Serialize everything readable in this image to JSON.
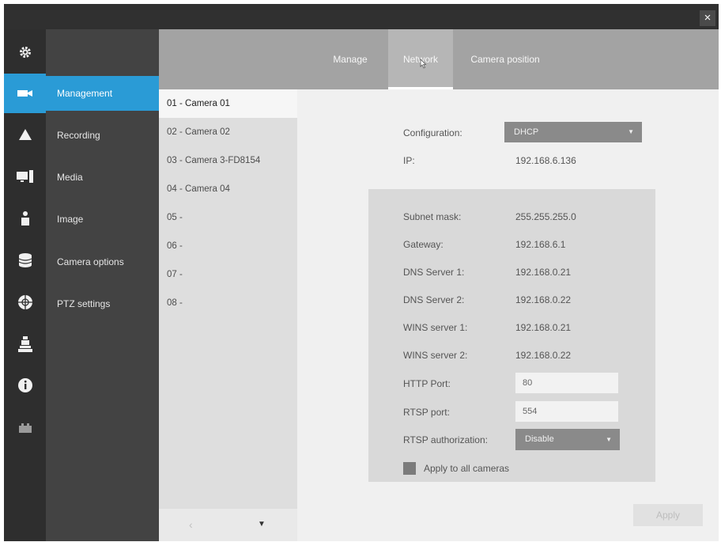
{
  "window": {
    "close_label": "×"
  },
  "iconbar": [
    {
      "icon": "gear-icon"
    },
    {
      "icon": "camera-icon",
      "active": true
    },
    {
      "icon": "alert-icon"
    },
    {
      "icon": "monitor-icon"
    },
    {
      "icon": "user-icon"
    },
    {
      "icon": "database-icon"
    },
    {
      "icon": "network-icon"
    },
    {
      "icon": "tools-icon"
    },
    {
      "icon": "info-icon"
    },
    {
      "icon": "plugin-icon"
    }
  ],
  "subnav": {
    "items": [
      {
        "label": "Management",
        "active": true
      },
      {
        "label": "Recording"
      },
      {
        "label": "Media"
      },
      {
        "label": "Image"
      },
      {
        "label": "Camera options"
      },
      {
        "label": "PTZ settings"
      }
    ]
  },
  "tabs": [
    {
      "label": "Manage"
    },
    {
      "label": "Network",
      "active": true
    },
    {
      "label": "Camera position"
    }
  ],
  "cameras": [
    {
      "label": "01 - Camera 01",
      "active": true
    },
    {
      "label": "02 - Camera 02"
    },
    {
      "label": "03 - Camera 3-FD8154"
    },
    {
      "label": "04 - Camera 04"
    },
    {
      "label": "05 -"
    },
    {
      "label": "06 -"
    },
    {
      "label": "07 -"
    },
    {
      "label": "08 -"
    }
  ],
  "pager": {
    "prev": "‹",
    "next": "▼"
  },
  "network": {
    "configuration_label": "Configuration:",
    "configuration_value": "DHCP",
    "ip_label": "IP:",
    "ip_value": "192.168.6.136",
    "subnet_label": "Subnet mask:",
    "subnet_value": "255.255.255.0",
    "gateway_label": "Gateway:",
    "gateway_value": "192.168.6.1",
    "dns1_label": "DNS Server 1:",
    "dns1_value": "192.168.0.21",
    "dns2_label": "DNS Server 2:",
    "dns2_value": "192.168.0.22",
    "wins1_label": "WINS server 1:",
    "wins1_value": "192.168.0.21",
    "wins2_label": "WINS server 2:",
    "wins2_value": "192.168.0.22",
    "http_label": "HTTP Port:",
    "http_value": "80",
    "rtsp_label": "RTSP port:",
    "rtsp_value": "554",
    "rtsp_auth_label": "RTSP authorization:",
    "rtsp_auth_value": "Disable",
    "apply_all_label": "Apply to all cameras"
  },
  "apply_button": "Apply",
  "colors": {
    "accent": "#2a9bd6",
    "sidebar": "#2e2e2e",
    "subnav": "#434343"
  }
}
